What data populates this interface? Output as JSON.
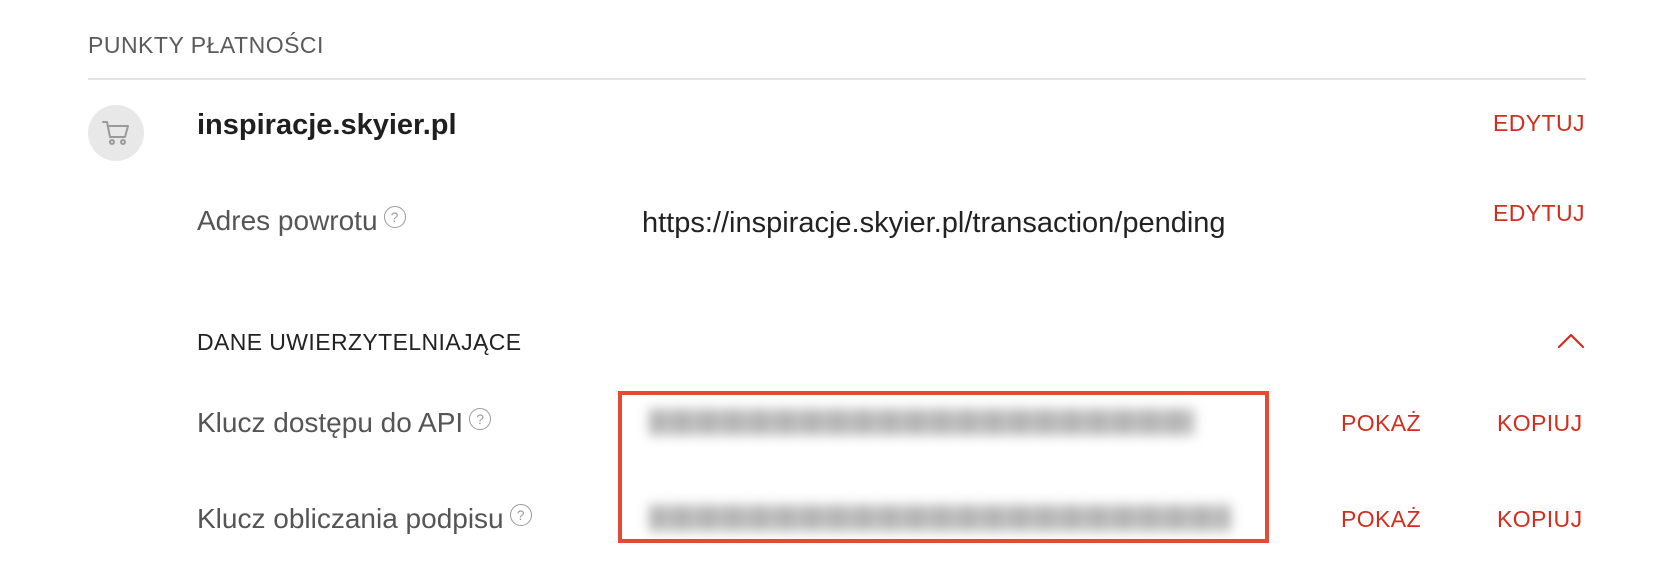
{
  "section": {
    "title": "PUNKTY PŁATNOŚCI"
  },
  "shop": {
    "icon": "cart-icon",
    "name": "inspiracje.skyier.pl",
    "edit_label": "EDYTUJ"
  },
  "return_address": {
    "label": "Adres powrotu",
    "value": "https://inspiracje.skyier.pl/transaction/pending",
    "edit_label": "EDYTUJ"
  },
  "credentials": {
    "title": "DANE UWIERZYTELNIAJĄCE",
    "collapse_icon": "chevron-up-icon",
    "api_key": {
      "label": "Klucz dostępu do API",
      "show_label": "POKAŻ",
      "copy_label": "KOPIUJ"
    },
    "signature_key": {
      "label": "Klucz obliczania podpisu",
      "show_label": "POKAŻ",
      "copy_label": "KOPIUJ"
    }
  },
  "colors": {
    "accent": "#d32d1e",
    "highlight": "#e64a35",
    "avatar_bg": "#e8e8e8"
  }
}
